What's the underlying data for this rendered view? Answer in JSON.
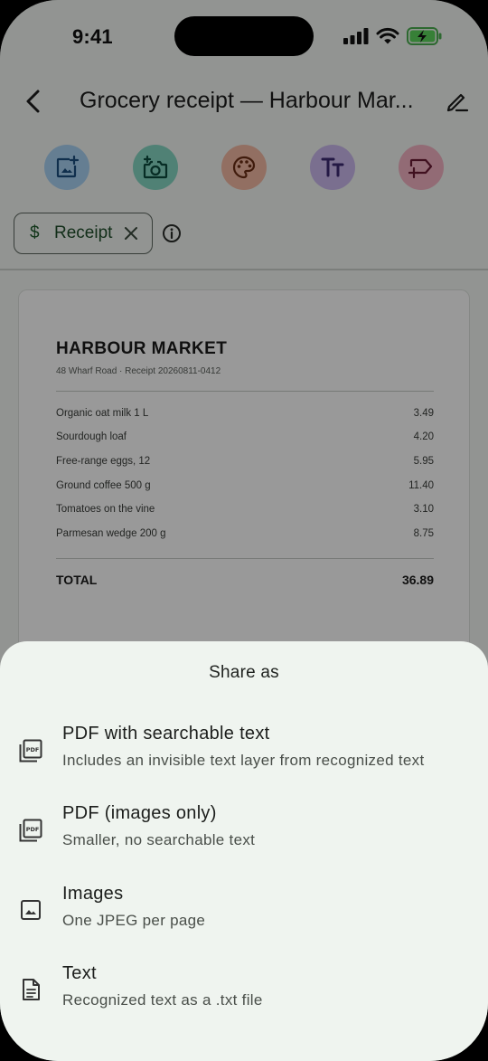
{
  "status_bar": {
    "time": "9:41"
  },
  "app_bar": {
    "title": "Grocery receipt — Harbour Mar..."
  },
  "tools": [
    {
      "icon": "add-photo-icon",
      "bg": "#a9d2f3",
      "color": "#1c4f80"
    },
    {
      "icon": "camera-add-icon",
      "bg": "#86d7c3",
      "color": "#0d4b3e"
    },
    {
      "icon": "palette-icon",
      "bg": "#f3b9a3",
      "color": "#6b2d14"
    },
    {
      "icon": "text-format-icon",
      "bg": "#cbb9ef",
      "color": "#3d2a73"
    },
    {
      "icon": "label-add-icon",
      "bg": "#f3b3c4",
      "color": "#6b1c35"
    }
  ],
  "chip": {
    "symbol": "$",
    "label": "Receipt"
  },
  "receipt": {
    "store": "HARBOUR MARKET",
    "subtitle": "48 Wharf Road · Receipt 20260811-0412",
    "items": [
      {
        "name": "Organic oat milk 1 L",
        "amount": "3.49"
      },
      {
        "name": "Sourdough loaf",
        "amount": "4.20"
      },
      {
        "name": "Free-range eggs, 12",
        "amount": "5.95"
      },
      {
        "name": "Ground coffee 500 g",
        "amount": "11.40"
      },
      {
        "name": "Tomatoes on the vine",
        "amount": "3.10"
      },
      {
        "name": "Parmesan wedge 200 g",
        "amount": "8.75"
      }
    ],
    "total_label": "TOTAL",
    "total_amount": "36.89"
  },
  "sheet": {
    "title": "Share as",
    "options": [
      {
        "icon": "pdf-icon",
        "title": "PDF with searchable text",
        "subtitle": "Includes an invisible text layer from recognized text"
      },
      {
        "icon": "pdf-icon",
        "title": "PDF (images only)",
        "subtitle": "Smaller, no searchable text"
      },
      {
        "icon": "image-icon",
        "title": "Images",
        "subtitle": "One JPEG per page"
      },
      {
        "icon": "text-file-icon",
        "title": "Text",
        "subtitle": "Recognized text as a .txt file"
      }
    ]
  }
}
